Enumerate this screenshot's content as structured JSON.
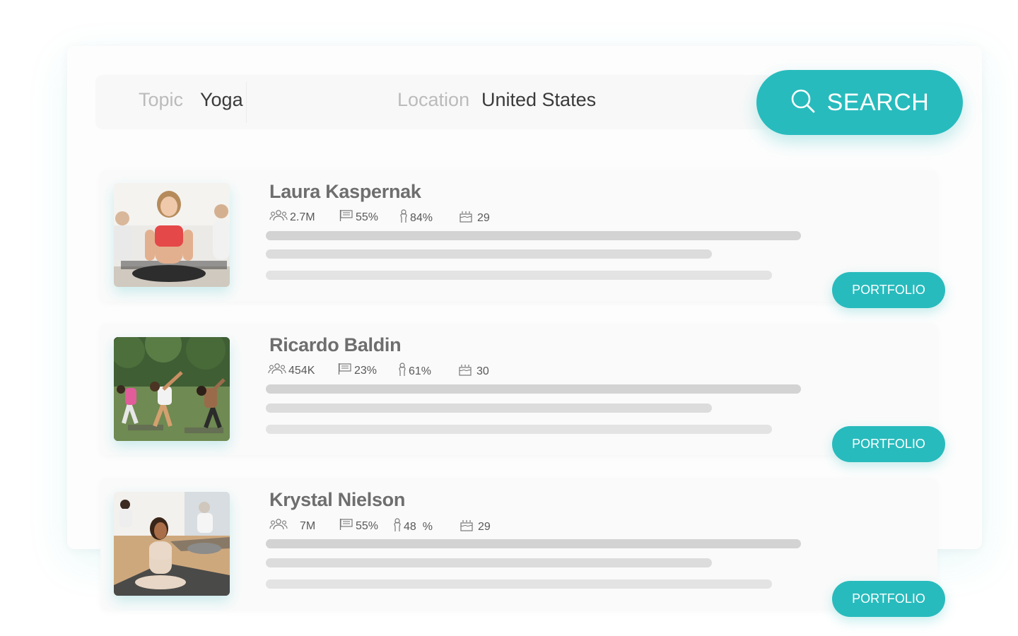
{
  "search": {
    "topic_label": "Topic",
    "topic_value": "Yoga",
    "location_label": "Location",
    "location_value": "United States",
    "button_label": "SEARCH"
  },
  "influencers": [
    {
      "name": "Laura Kaspernak",
      "followers": "2.7M",
      "country_pct": "55%",
      "gender_pct": "84%",
      "age": "29",
      "button_label": "PORTFOLIO"
    },
    {
      "name": "Ricardo Baldin",
      "followers": "454K",
      "country_pct": "23%",
      "gender_pct": "61%",
      "age": "30",
      "button_label": "PORTFOLIO"
    },
    {
      "name": "Krystal Nielson",
      "followers": "7M",
      "country_pct": "55%",
      "gender_pct": "48  %",
      "age": "29",
      "button_label": "PORTFOLIO"
    }
  ],
  "colors": {
    "accent": "#28bbbd",
    "name_text": "#6e6e6e",
    "placeholder": "#d3d3d3"
  },
  "icons": [
    "search-icon",
    "followers-icon",
    "flag-icon",
    "gender-icon",
    "cake-icon"
  ]
}
